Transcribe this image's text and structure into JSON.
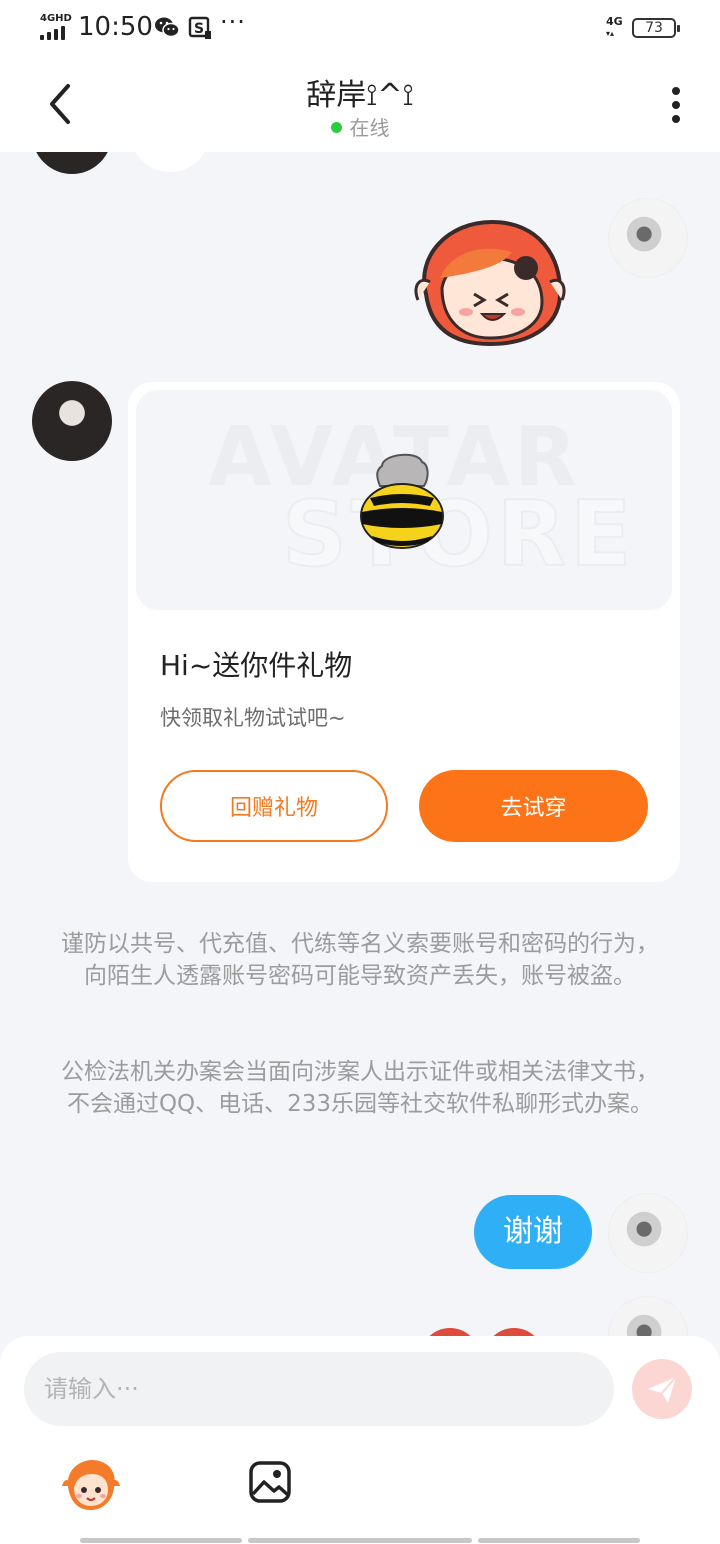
{
  "status_bar": {
    "network": "4GHD",
    "time": "10:50",
    "more": "···",
    "mobile": "4G",
    "battery": "73"
  },
  "header": {
    "title": "辞岸⟟^⟟",
    "presence": "在线"
  },
  "gift_card": {
    "watermark_line1": "AVATAR",
    "watermark_line2": "STORE",
    "title": "Hi~送你件礼物",
    "subtitle": "快领取礼物试试吧~",
    "return_label": "回赠礼物",
    "try_label": "去试穿"
  },
  "notices": [
    "谨防以共号、代充值、代练等名义索要账号和密码的行为，向陌生人透露账号密码可能导致资产丢失，账号被盗。",
    "公检法机关办案会当面向涉案人出示证件或相关法律文书，不会通过QQ、电话、233乐园等社交软件私聊形式办案。"
  ],
  "messages": [
    {
      "text": "谢谢"
    }
  ],
  "input": {
    "placeholder": "请输入···"
  },
  "icons": {
    "back": "chevron-left-icon",
    "more": "more-vertical-icon",
    "send": "paper-plane-icon",
    "sticker": "sticker-icon",
    "image": "image-icon"
  },
  "colors": {
    "accent_orange": "#fc7417",
    "bubble_blue": "#2fb0f6",
    "online_green": "#2ecc40",
    "send_disabled": "#fbd6d2"
  }
}
